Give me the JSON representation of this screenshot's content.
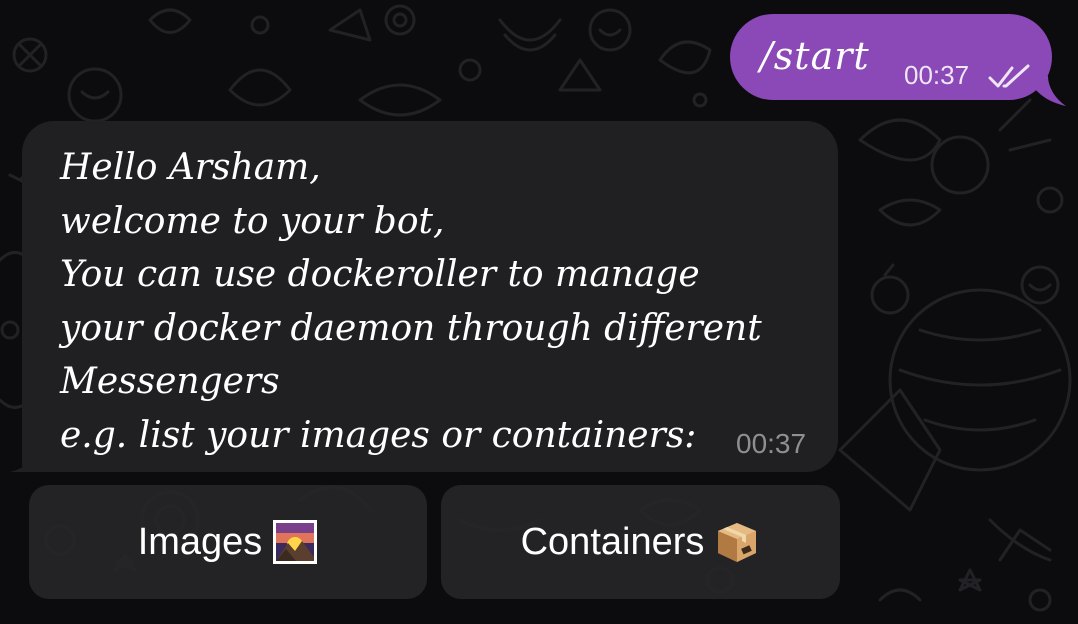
{
  "chat": {
    "outgoing": {
      "text": "/start",
      "time": "00:37",
      "status_icon": "double-check-icon"
    },
    "incoming": {
      "lines": [
        "Hello Arsham,",
        "welcome to your bot,",
        "You can use dockeroller to manage",
        "your docker daemon through different",
        "Messengers",
        "e.g. list your images or containers:"
      ],
      "time": "00:37"
    },
    "keyboard": {
      "buttons": [
        {
          "label": "Images",
          "icon": "sunrise-over-mountains-emoji-icon"
        },
        {
          "label": "Containers",
          "icon": "package-box-emoji-icon"
        }
      ]
    }
  },
  "colors": {
    "background": "#0c0c0e",
    "outgoing_bubble": "#8b48b7",
    "incoming_bubble": "#202022",
    "keyboard_button": "#262628",
    "timestamp_in": "#8e8e93",
    "doodle": "#1f1f22"
  }
}
